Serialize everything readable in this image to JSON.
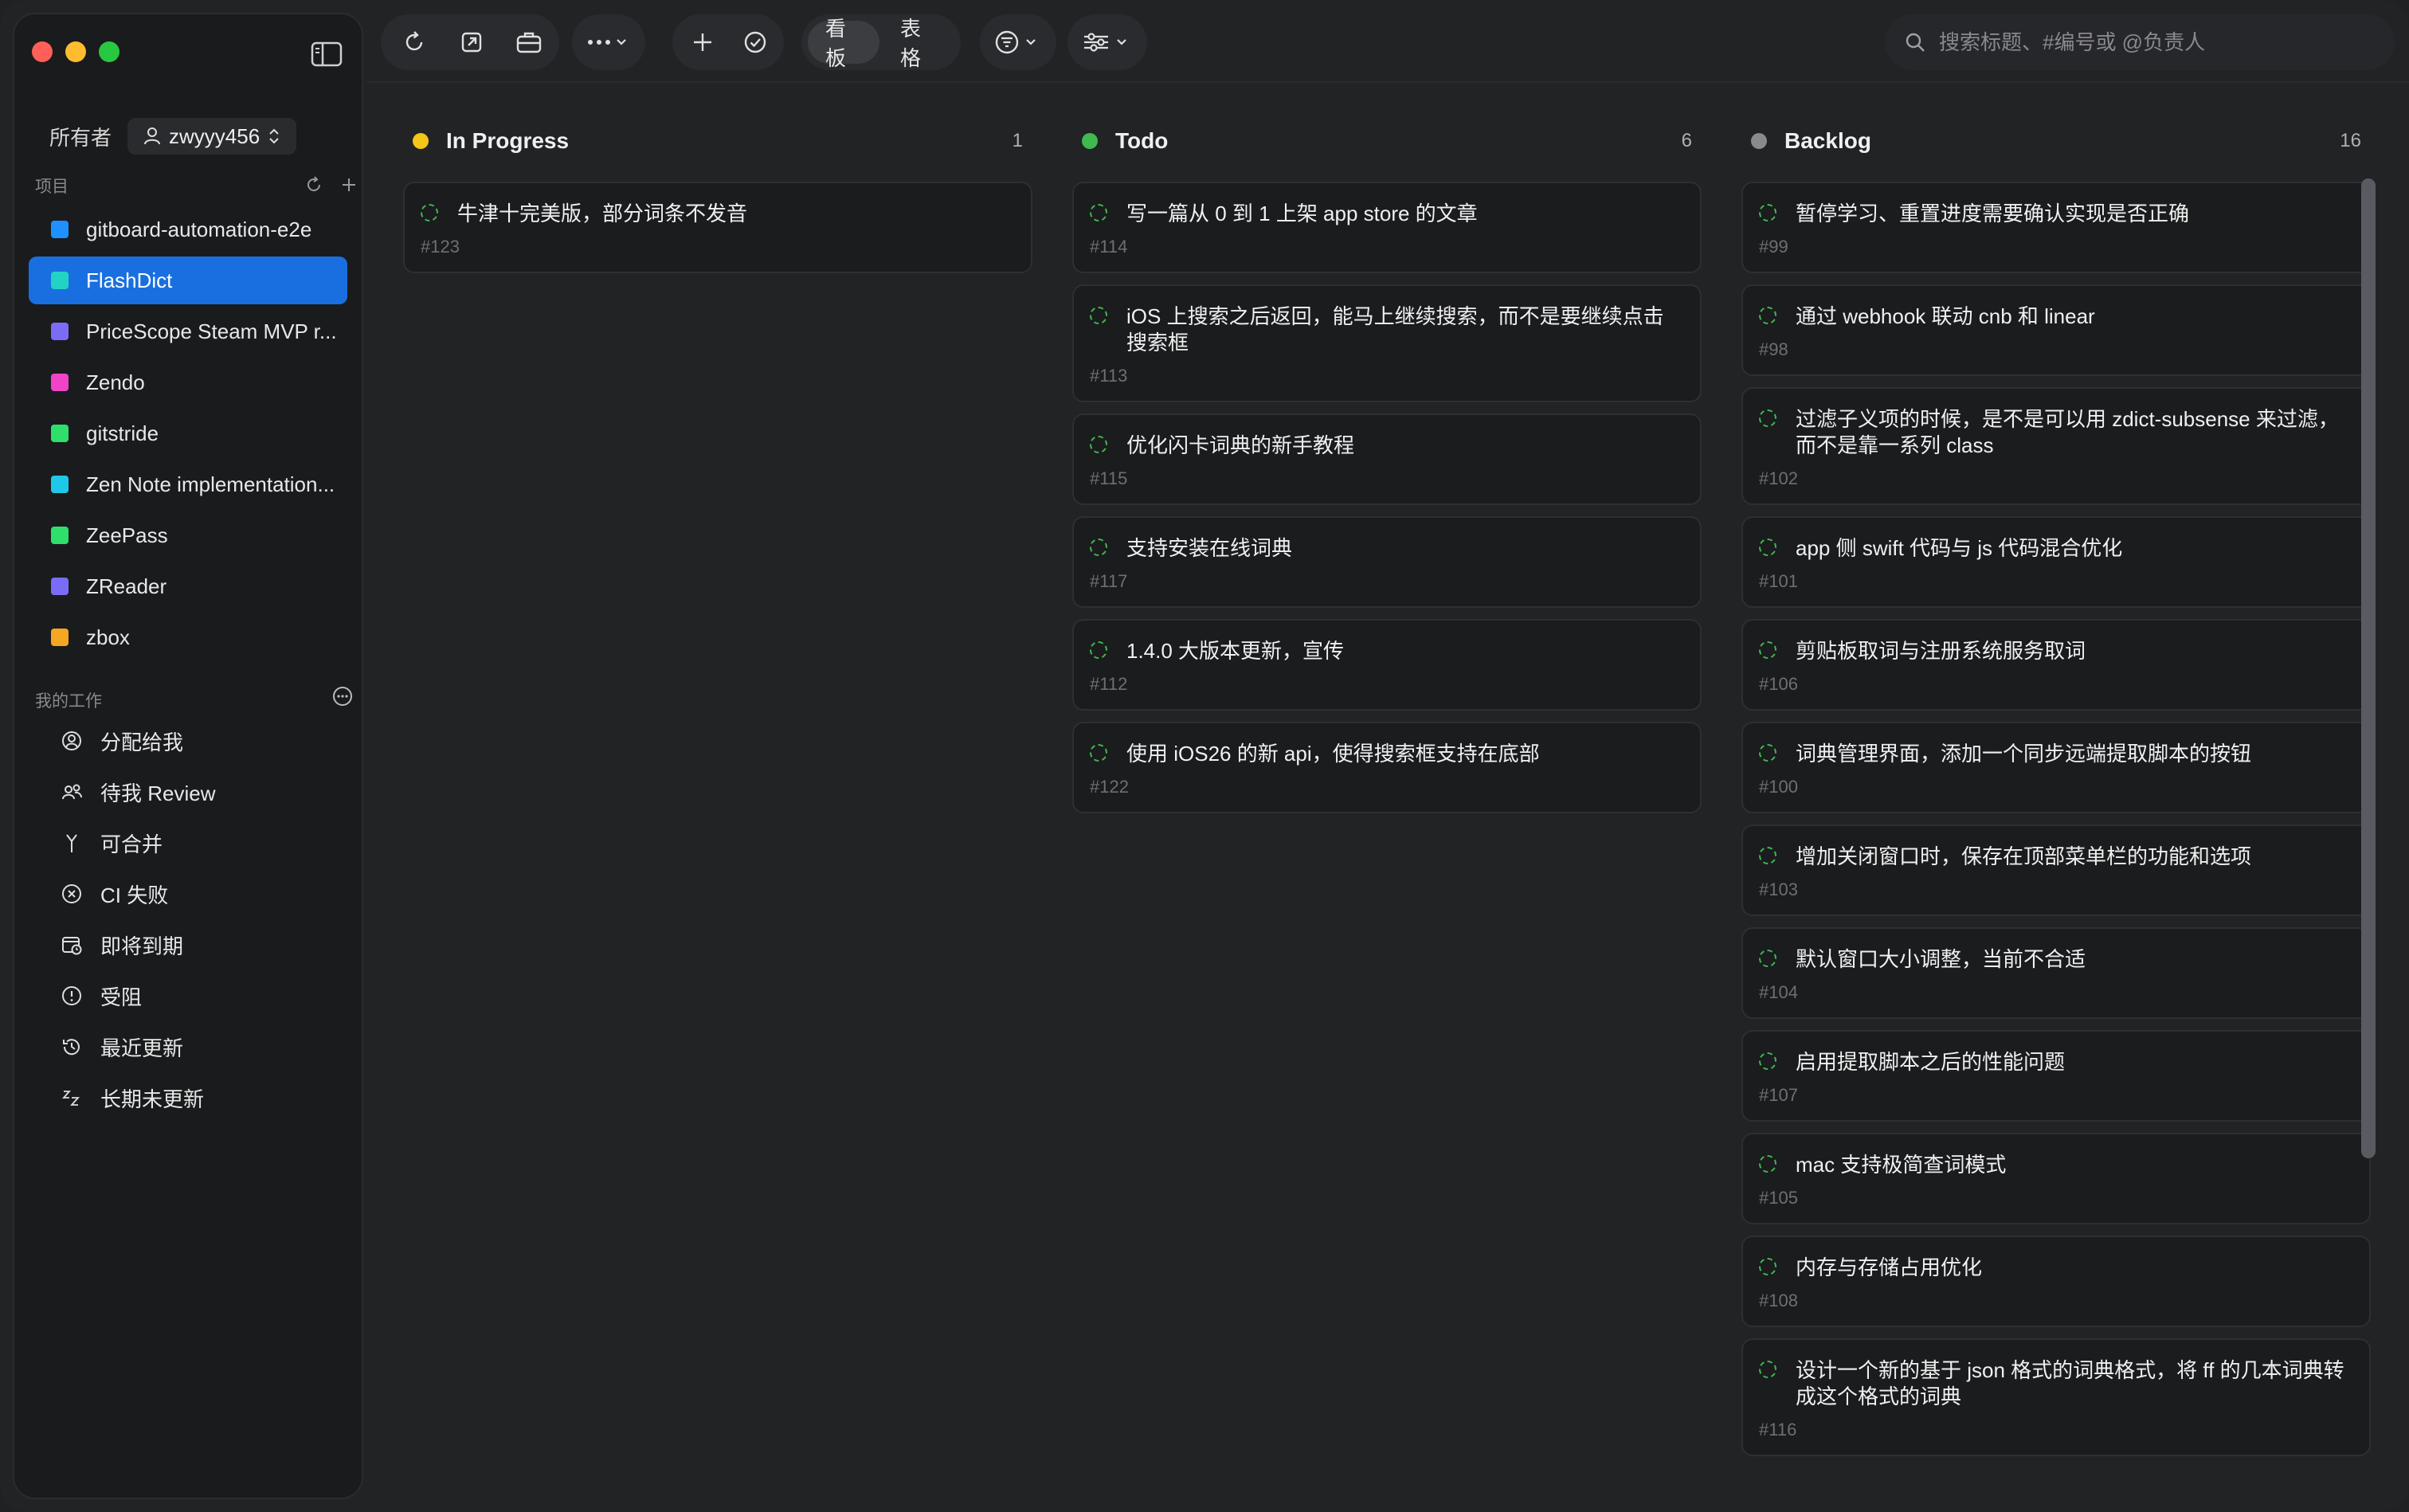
{
  "window": {
    "traffic_lights": [
      "#ff5f57",
      "#febc2e",
      "#28c840"
    ]
  },
  "sidebar": {
    "owner_label": "所有者",
    "owner_value": "zwyyy456",
    "projects_heading": "项目",
    "projects": [
      {
        "label": "gitboard-automation-e2e",
        "color": "#1e90ff",
        "active": false
      },
      {
        "label": "FlashDict",
        "color": "#22d3c5",
        "active": true
      },
      {
        "label": "PriceScope Steam MVP r...",
        "color": "#7b6cf6",
        "active": false
      },
      {
        "label": "Zendo",
        "color": "#f043c8",
        "active": false
      },
      {
        "label": "gitstride",
        "color": "#2ee06b",
        "active": false
      },
      {
        "label": "Zen Note implementation...",
        "color": "#1ec8e8",
        "active": false
      },
      {
        "label": "ZeePass",
        "color": "#2ee06b",
        "active": false
      },
      {
        "label": "ZReader",
        "color": "#7b6cf6",
        "active": false
      },
      {
        "label": "zbox",
        "color": "#f5a623",
        "active": false
      }
    ],
    "mywork_heading": "我的工作",
    "mywork": [
      {
        "label": "分配给我",
        "icon": "person-circle-icon"
      },
      {
        "label": "待我 Review",
        "icon": "review-people-icon"
      },
      {
        "label": "可合并",
        "icon": "merge-icon"
      },
      {
        "label": "CI 失败",
        "icon": "x-circle-icon"
      },
      {
        "label": "即将到期",
        "icon": "calendar-clock-icon"
      },
      {
        "label": "受阻",
        "icon": "alert-circle-icon"
      },
      {
        "label": "最近更新",
        "icon": "history-icon"
      },
      {
        "label": "长期未更新",
        "icon": "sleep-zz-icon"
      }
    ]
  },
  "toolbar": {
    "view_board": "看板",
    "view_table": "表格",
    "search_placeholder": "搜索标题、#编号或 @负责人"
  },
  "columns": [
    {
      "title": "In Progress",
      "count": "1",
      "color": "#f5c518",
      "cards": [
        {
          "title": "牛津十完美版，部分词条不发音",
          "id": "#123"
        }
      ]
    },
    {
      "title": "Todo",
      "count": "6",
      "color": "#3fb950",
      "cards": [
        {
          "title": "写一篇从 0 到 1 上架 app store 的文章",
          "id": "#114"
        },
        {
          "title": "iOS 上搜索之后返回，能马上继续搜索，而不是要继续点击搜索框",
          "id": "#113"
        },
        {
          "title": "优化闪卡词典的新手教程",
          "id": "#115"
        },
        {
          "title": "支持安装在线词典",
          "id": "#117"
        },
        {
          "title": "1.4.0 大版本更新，宣传",
          "id": "#112"
        },
        {
          "title": "使用 iOS26 的新 api，使得搜索框支持在底部",
          "id": "#122"
        }
      ]
    },
    {
      "title": "Backlog",
      "count": "16",
      "color": "#8a8a8e",
      "cards": [
        {
          "title": "暂停学习、重置进度需要确认实现是否正确",
          "id": "#99"
        },
        {
          "title": "通过 webhook 联动 cnb 和 linear",
          "id": "#98"
        },
        {
          "title": "过滤子义项的时候，是不是可以用 zdict-subsense 来过滤，而不是靠一系列 class",
          "id": "#102"
        },
        {
          "title": "app 侧 swift 代码与 js 代码混合优化",
          "id": "#101"
        },
        {
          "title": "剪贴板取词与注册系统服务取词",
          "id": "#106"
        },
        {
          "title": "词典管理界面，添加一个同步远端提取脚本的按钮",
          "id": "#100"
        },
        {
          "title": "增加关闭窗口时，保存在顶部菜单栏的功能和选项",
          "id": "#103"
        },
        {
          "title": "默认窗口大小调整，当前不合适",
          "id": "#104"
        },
        {
          "title": "启用提取脚本之后的性能问题",
          "id": "#107"
        },
        {
          "title": "mac 支持极简查词模式",
          "id": "#105"
        },
        {
          "title": "内存与存储占用优化",
          "id": "#108"
        },
        {
          "title": "设计一个新的基于 json 格式的词典格式，将 ff 的几本词典转成这个格式的词典",
          "id": "#116"
        }
      ]
    }
  ]
}
